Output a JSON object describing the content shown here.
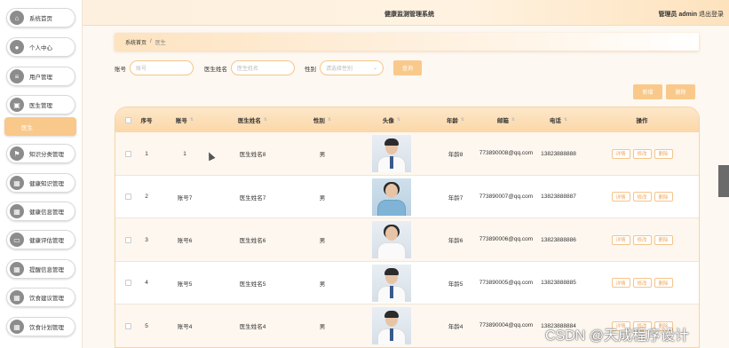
{
  "header": {
    "title": "健康监测管理系统",
    "user": "管理员 admin",
    "logout": "退出登录"
  },
  "sidebar": {
    "items": [
      {
        "label": "系统首页",
        "icon": "home-icon"
      },
      {
        "label": "个人中心",
        "icon": "user-icon"
      },
      {
        "label": "用户管理",
        "icon": "list-icon"
      },
      {
        "label": "医生管理",
        "icon": "doctor-icon"
      },
      {
        "label": "医生",
        "icon": "",
        "active": true
      },
      {
        "label": "知识分类管理",
        "icon": "flag-icon"
      },
      {
        "label": "健康知识管理",
        "icon": "grid-icon"
      },
      {
        "label": "健康信息管理",
        "icon": "grid-icon"
      },
      {
        "label": "健康评估管理",
        "icon": "chat-icon"
      },
      {
        "label": "提醒信息管理",
        "icon": "grid-icon"
      },
      {
        "label": "饮食建议管理",
        "icon": "grid-icon"
      },
      {
        "label": "饮食计划管理",
        "icon": "grid-icon"
      }
    ]
  },
  "breadcrumb": {
    "home": "系统首页",
    "separator": "/",
    "current": "医生"
  },
  "search": {
    "account_label": "账号",
    "account_placeholder": "账号",
    "name_label": "医生姓名",
    "name_placeholder": "医生姓名",
    "gender_label": "性别",
    "gender_placeholder": "请选择性别",
    "query_button": "查询"
  },
  "actions": {
    "add": "新增",
    "delete": "删除"
  },
  "table": {
    "columns": [
      "",
      "序号",
      "账号",
      "医生姓名",
      "性别",
      "头像",
      "年龄",
      "邮箱",
      "电话",
      "操作"
    ],
    "rows": [
      {
        "index": "1",
        "account": "1",
        "name": "医生姓名8",
        "gender": "男",
        "age": "年龄8",
        "email": "773890008@qq.com",
        "phone": "13823888888"
      },
      {
        "index": "2",
        "account": "账号7",
        "name": "医生姓名7",
        "gender": "男",
        "age": "年龄7",
        "email": "773890007@qq.com",
        "phone": "13823888887"
      },
      {
        "index": "3",
        "account": "账号6",
        "name": "医生姓名6",
        "gender": "男",
        "age": "年龄6",
        "email": "773890006@qq.com",
        "phone": "13823888886"
      },
      {
        "index": "4",
        "account": "账号5",
        "name": "医生姓名5",
        "gender": "男",
        "age": "年龄5",
        "email": "773890005@qq.com",
        "phone": "13823888885"
      },
      {
        "index": "5",
        "account": "账号4",
        "name": "医生姓名4",
        "gender": "男",
        "age": "年龄4",
        "email": "773890004@qq.com",
        "phone": "13823888884"
      }
    ],
    "op_labels": {
      "detail": "详情",
      "edit": "修改",
      "delete": "删除"
    }
  },
  "watermark": "CSDN @天成程序设计",
  "colors": {
    "accent": "#f9c98b",
    "header_bg": "#fde7c9"
  }
}
